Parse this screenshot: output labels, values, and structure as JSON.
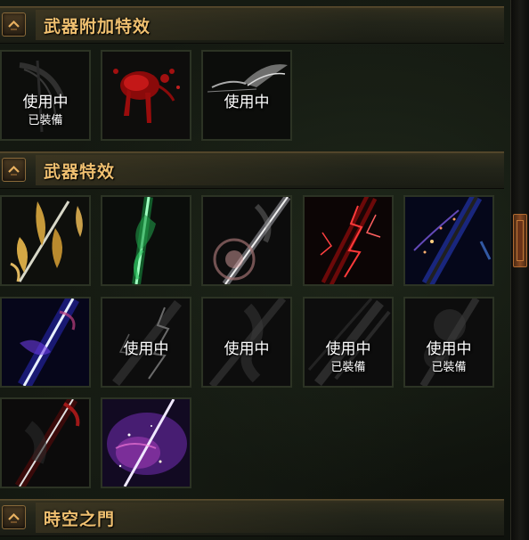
{
  "sections": [
    {
      "title": "武器附加特效"
    },
    {
      "title": "武器特效"
    },
    {
      "title": "時空之門"
    }
  ],
  "add_effects": [
    {
      "status": "使用中",
      "sub": "已裝備",
      "art": "dark-slash"
    },
    {
      "status": "",
      "sub": "",
      "art": "blood-splash"
    },
    {
      "status": "使用中",
      "sub": "",
      "art": "white-wings"
    }
  ],
  "weapon_effects": [
    {
      "status": "",
      "sub": "",
      "art": "golden-feathers"
    },
    {
      "status": "",
      "sub": "",
      "art": "green-flame-blade"
    },
    {
      "status": "",
      "sub": "",
      "art": "silver-ring-blade"
    },
    {
      "status": "",
      "sub": "",
      "art": "red-lightning-blade"
    },
    {
      "status": "",
      "sub": "",
      "art": "blue-starry-blade"
    },
    {
      "status": "",
      "sub": "",
      "art": "blue-energy-blade"
    },
    {
      "status": "使用中",
      "sub": "",
      "art": "grey-lightning"
    },
    {
      "status": "使用中",
      "sub": "",
      "art": "grey-smoke"
    },
    {
      "status": "使用中",
      "sub": "已裝備",
      "art": "grey-streaks"
    },
    {
      "status": "使用中",
      "sub": "已裝備",
      "art": "grey-mist"
    },
    {
      "status": "",
      "sub": "",
      "art": "crimson-shadow-blade"
    },
    {
      "status": "",
      "sub": "",
      "art": "purple-galaxy-blade"
    }
  ],
  "colors": {
    "header_text": "#f0c070",
    "frame": "#2c3324"
  }
}
